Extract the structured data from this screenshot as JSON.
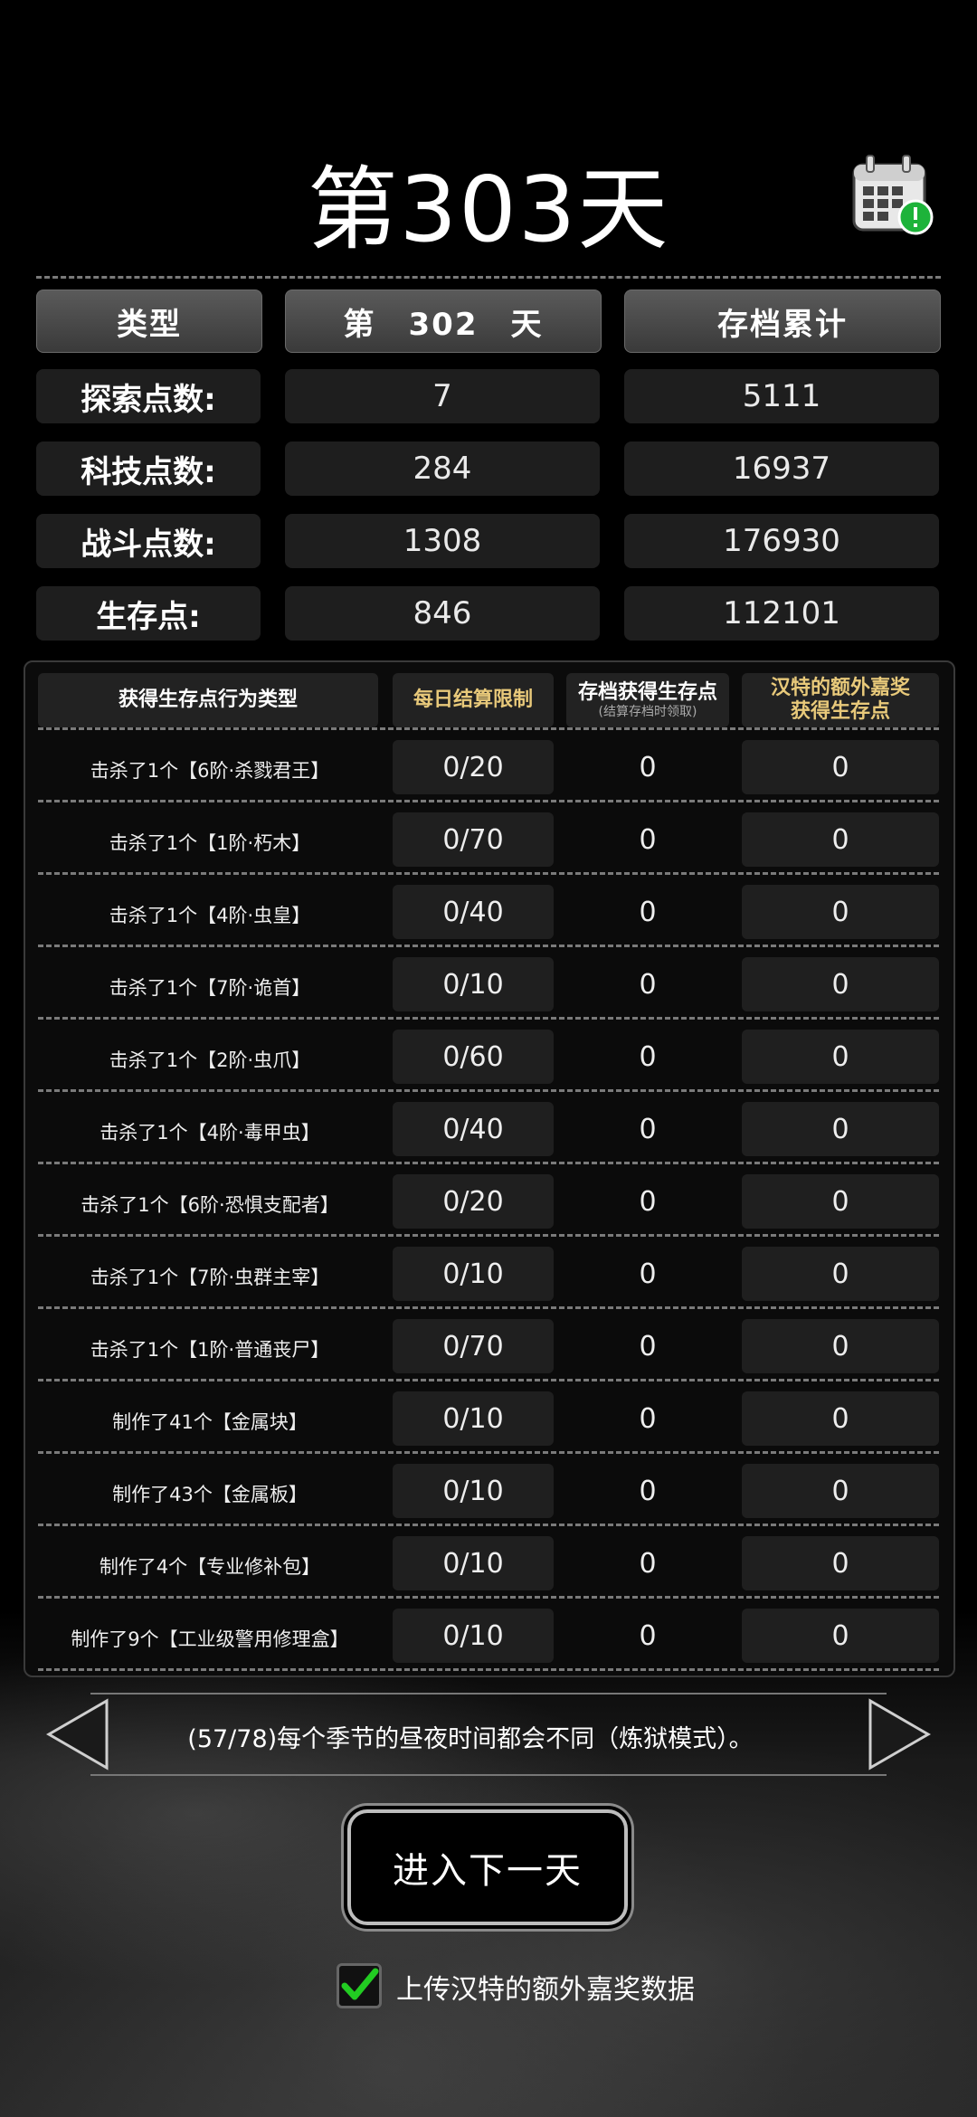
{
  "title": "第303天",
  "summary": {
    "header": [
      "类型",
      "第　302　天",
      "存档累计"
    ],
    "rows": [
      {
        "label": "探索点数:",
        "day": "7",
        "total": "5111"
      },
      {
        "label": "科技点数:",
        "day": "284",
        "total": "16937"
      },
      {
        "label": "战斗点数:",
        "day": "1308",
        "total": "176930"
      },
      {
        "label": "生存点:",
        "day": "846",
        "total": "112101"
      }
    ]
  },
  "table": {
    "col1": "获得生存点行为类型",
    "col2": "每日结算限制",
    "col3": "存档获得生存点",
    "col3_sub": "(结算存档时领取)",
    "col4_line1": "汉特的额外嘉奖",
    "col4_line2": "获得生存点",
    "rows": [
      {
        "label": "击杀了1个【6阶·杀戮君王】",
        "limit": "0/20",
        "save": "0",
        "bonus": "0"
      },
      {
        "label": "击杀了1个【1阶·朽木】",
        "limit": "0/70",
        "save": "0",
        "bonus": "0"
      },
      {
        "label": "击杀了1个【4阶·虫皇】",
        "limit": "0/40",
        "save": "0",
        "bonus": "0"
      },
      {
        "label": "击杀了1个【7阶·诡首】",
        "limit": "0/10",
        "save": "0",
        "bonus": "0"
      },
      {
        "label": "击杀了1个【2阶·虫爪】",
        "limit": "0/60",
        "save": "0",
        "bonus": "0"
      },
      {
        "label": "击杀了1个【4阶·毒甲虫】",
        "limit": "0/40",
        "save": "0",
        "bonus": "0"
      },
      {
        "label": "击杀了1个【6阶·恐惧支配者】",
        "limit": "0/20",
        "save": "0",
        "bonus": "0"
      },
      {
        "label": "击杀了1个【7阶·虫群主宰】",
        "limit": "0/10",
        "save": "0",
        "bonus": "0"
      },
      {
        "label": "击杀了1个【1阶·普通丧尸】",
        "limit": "0/70",
        "save": "0",
        "bonus": "0"
      },
      {
        "label": "制作了41个【金属块】",
        "limit": "0/10",
        "save": "0",
        "bonus": "0"
      },
      {
        "label": "制作了43个【金属板】",
        "limit": "0/10",
        "save": "0",
        "bonus": "0"
      },
      {
        "label": "制作了4个【专业修补包】",
        "limit": "0/10",
        "save": "0",
        "bonus": "0"
      },
      {
        "label": "制作了9个【工业级警用修理盒】",
        "limit": "0/10",
        "save": "0",
        "bonus": "0"
      }
    ]
  },
  "tip": "(57/78)每个季节的昼夜时间都会不同（炼狱模式）。",
  "next_button": "进入下一天",
  "upload_label": "上传汉特的额外嘉奖数据",
  "upload_checked": true,
  "icons": {
    "calendar": "calendar-alert-icon",
    "prev": "arrow-left-icon",
    "next": "arrow-right-icon",
    "check": "checkmark-icon"
  },
  "colors": {
    "alert_green": "#1db33a",
    "gold_header": "#e8c97a",
    "check_green": "#22cc22"
  }
}
